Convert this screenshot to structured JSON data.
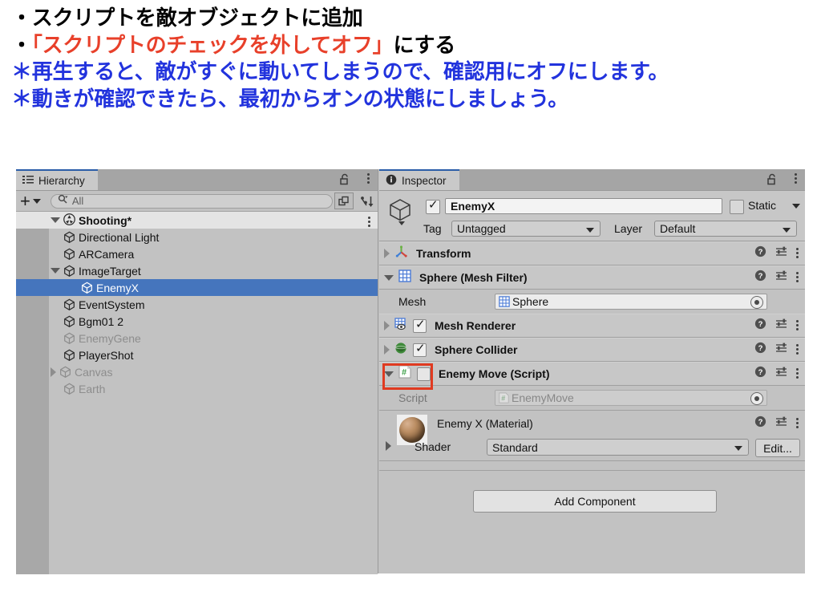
{
  "slide": {
    "line1": "・スクリプトを敵オブジェクトに追加",
    "line2_pre": "・",
    "line2_hl": "「スクリプトのチェックを外してオフ」",
    "line2_post": "にする",
    "line3": "＊再生すると、敵がすぐに動いてしまうので、確認用にオフにします。",
    "line4": "＊動きが確認できたら、最初からオンの状態にしましょう。",
    "colors": {
      "black": "#000000",
      "red": "#e8402a",
      "blue": "#2233dd"
    }
  },
  "hierarchy": {
    "tab_label": "Hierarchy",
    "tab_icon": "hierarchy-icon",
    "lock_icon": "lock-open-icon",
    "menu_icon": "kebab-menu-icon",
    "toolbar": {
      "add_label": "+",
      "search_placeholder": "All",
      "search_value": "All",
      "search_icon": "search-icon",
      "save_search_icon": "save-search-icon",
      "sort_icon": "sort-icon"
    },
    "scene": {
      "label": "Shooting*",
      "icon": "unity-scene-icon",
      "expanded": true
    },
    "items": [
      {
        "label": "Directional Light",
        "icon": "gameobject-icon",
        "indent": 2,
        "expandable": false,
        "selected": false,
        "dim": false
      },
      {
        "label": "ARCamera",
        "icon": "gameobject-icon",
        "indent": 2,
        "expandable": false,
        "selected": false,
        "dim": false
      },
      {
        "label": "ImageTarget",
        "icon": "gameobject-icon",
        "indent": 2,
        "expandable": true,
        "expanded": true,
        "selected": false,
        "dim": false
      },
      {
        "label": "EnemyX",
        "icon": "gameobject-icon",
        "indent": 3,
        "expandable": false,
        "selected": true,
        "dim": false
      },
      {
        "label": "EventSystem",
        "icon": "gameobject-icon",
        "indent": 2,
        "expandable": false,
        "selected": false,
        "dim": false
      },
      {
        "label": "Bgm01 2",
        "icon": "gameobject-icon",
        "indent": 2,
        "expandable": false,
        "selected": false,
        "dim": false
      },
      {
        "label": "EnemyGene",
        "icon": "gameobject-icon",
        "indent": 2,
        "expandable": false,
        "selected": false,
        "dim": true
      },
      {
        "label": "PlayerShot",
        "icon": "gameobject-icon",
        "indent": 2,
        "expandable": false,
        "selected": false,
        "dim": false
      },
      {
        "label": "Canvas",
        "icon": "gameobject-icon",
        "indent": 2,
        "expandable": true,
        "expanded": false,
        "selected": false,
        "dim": true
      },
      {
        "label": "Earth",
        "icon": "gameobject-icon",
        "indent": 2,
        "expandable": false,
        "selected": false,
        "dim": true
      }
    ],
    "selection_color": "#4575bd"
  },
  "inspector": {
    "tab_label": "Inspector",
    "tab_icon": "info-icon",
    "lock_icon": "lock-open-icon",
    "menu_icon": "kebab-menu-icon",
    "object": {
      "enabled": true,
      "name": "EnemyX",
      "icon": "gameobject-cube-icon",
      "static_label": "Static",
      "static_checked": false,
      "tag_label": "Tag",
      "tag_value": "Untagged",
      "layer_label": "Layer",
      "layer_value": "Default"
    },
    "components": [
      {
        "title": "Transform",
        "icon": "transform-axis-icon",
        "expanded": false,
        "has_checkbox": false
      },
      {
        "title": "Sphere (Mesh Filter)",
        "icon": "mesh-filter-icon",
        "expanded": true,
        "has_checkbox": false
      },
      {
        "title": "Mesh Renderer",
        "icon": "mesh-renderer-icon",
        "expanded": false,
        "has_checkbox": true,
        "checked": true
      },
      {
        "title": "Sphere Collider",
        "icon": "sphere-collider-icon",
        "expanded": false,
        "has_checkbox": true,
        "checked": true
      },
      {
        "title": "Enemy Move (Script)",
        "icon": "csharp-script-icon",
        "expanded": true,
        "has_checkbox": true,
        "checked": false,
        "highlighted": true
      }
    ],
    "mesh_row": {
      "label": "Mesh",
      "value": "Sphere",
      "icon": "mesh-filter-icon"
    },
    "script_row": {
      "label": "Script",
      "value": "EnemyMove",
      "icon": "csharp-script-icon",
      "disabled": true
    },
    "material": {
      "title": "Enemy X (Material)",
      "shader_label": "Shader",
      "shader_value": "Standard",
      "edit_label": "Edit...",
      "preview_icon": "material-sphere-preview"
    },
    "add_component_label": "Add Component",
    "header_icons": {
      "help": "help-icon",
      "preset": "preset-settings-icon",
      "menu": "kebab-menu-icon"
    },
    "highlight_color": "#e03a20"
  }
}
